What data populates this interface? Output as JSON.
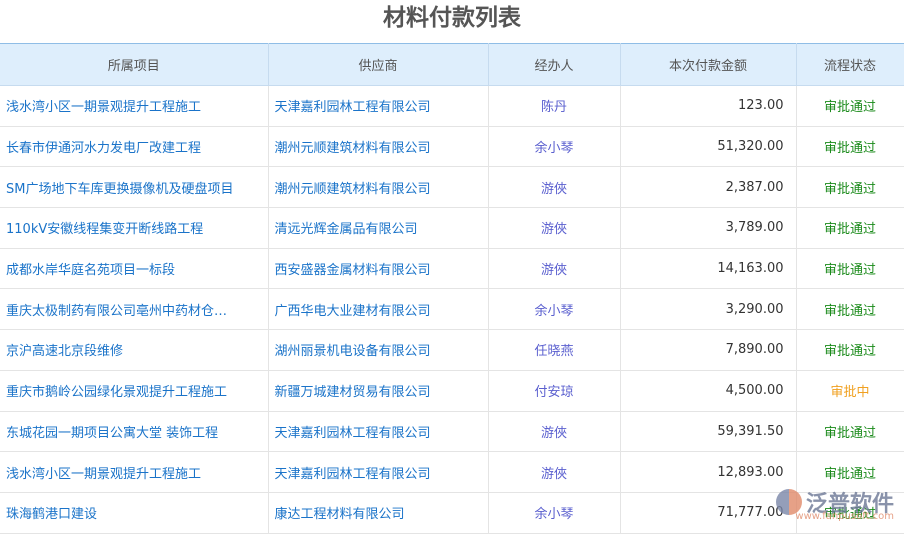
{
  "title": "材料付款列表",
  "headers": [
    "所属项目",
    "供应商",
    "经办人",
    "本次付款金额",
    "流程状态"
  ],
  "colors": {
    "approved": "#1a8a1a",
    "pending": "#f0a020"
  },
  "rows": [
    {
      "project": "浅水湾小区一期景观提升工程施工",
      "supplier": "天津嘉利园林工程有限公司",
      "handler": "陈丹",
      "amount": "123.00",
      "status": "审批通过"
    },
    {
      "project": "长春市伊通河水力发电厂改建工程",
      "supplier": "潮州元顺建筑材料有限公司",
      "handler": "余小琴",
      "amount": "51,320.00",
      "status": "审批通过"
    },
    {
      "project": "SM广场地下车库更换摄像机及硬盘项目",
      "supplier": "潮州元顺建筑材料有限公司",
      "handler": "游俠",
      "amount": "2,387.00",
      "status": "审批通过"
    },
    {
      "project": "110kV安徽线程集变开断线路工程",
      "supplier": "清远光辉金属品有限公司",
      "handler": "游俠",
      "amount": "3,789.00",
      "status": "审批通过"
    },
    {
      "project": "成都水岸华庭名苑项目一标段",
      "supplier": "西安盛器金属材料有限公司",
      "handler": "游俠",
      "amount": "14,163.00",
      "status": "审批通过"
    },
    {
      "project": "重庆太极制药有限公司亳州中药材仓…",
      "supplier": "广西华电大业建材有限公司",
      "handler": "余小琴",
      "amount": "3,290.00",
      "status": "审批通过"
    },
    {
      "project": "京沪高速北京段维修",
      "supplier": "湖州丽景机电设备有限公司",
      "handler": "任晓燕",
      "amount": "7,890.00",
      "status": "审批通过"
    },
    {
      "project": "重庆市鹅岭公园绿化景观提升工程施工",
      "supplier": "新疆万城建材贸易有限公司",
      "handler": "付安琼",
      "amount": "4,500.00",
      "status": "审批中"
    },
    {
      "project": "东城花园一期项目公寓大堂 装饰工程",
      "supplier": "天津嘉利园林工程有限公司",
      "handler": "游俠",
      "amount": "59,391.50",
      "status": "审批通过"
    },
    {
      "project": "浅水湾小区一期景观提升工程施工",
      "supplier": "天津嘉利园林工程有限公司",
      "handler": "游俠",
      "amount": "12,893.00",
      "status": "审批通过"
    },
    {
      "project": "珠海鹤港口建设",
      "supplier": "康达工程材料有限公司",
      "handler": "余小琴",
      "amount": "71,777.00",
      "status": "审批通过"
    }
  ],
  "watermark": {
    "name": "泛普软件",
    "url": "www.fanpusoft.com"
  }
}
